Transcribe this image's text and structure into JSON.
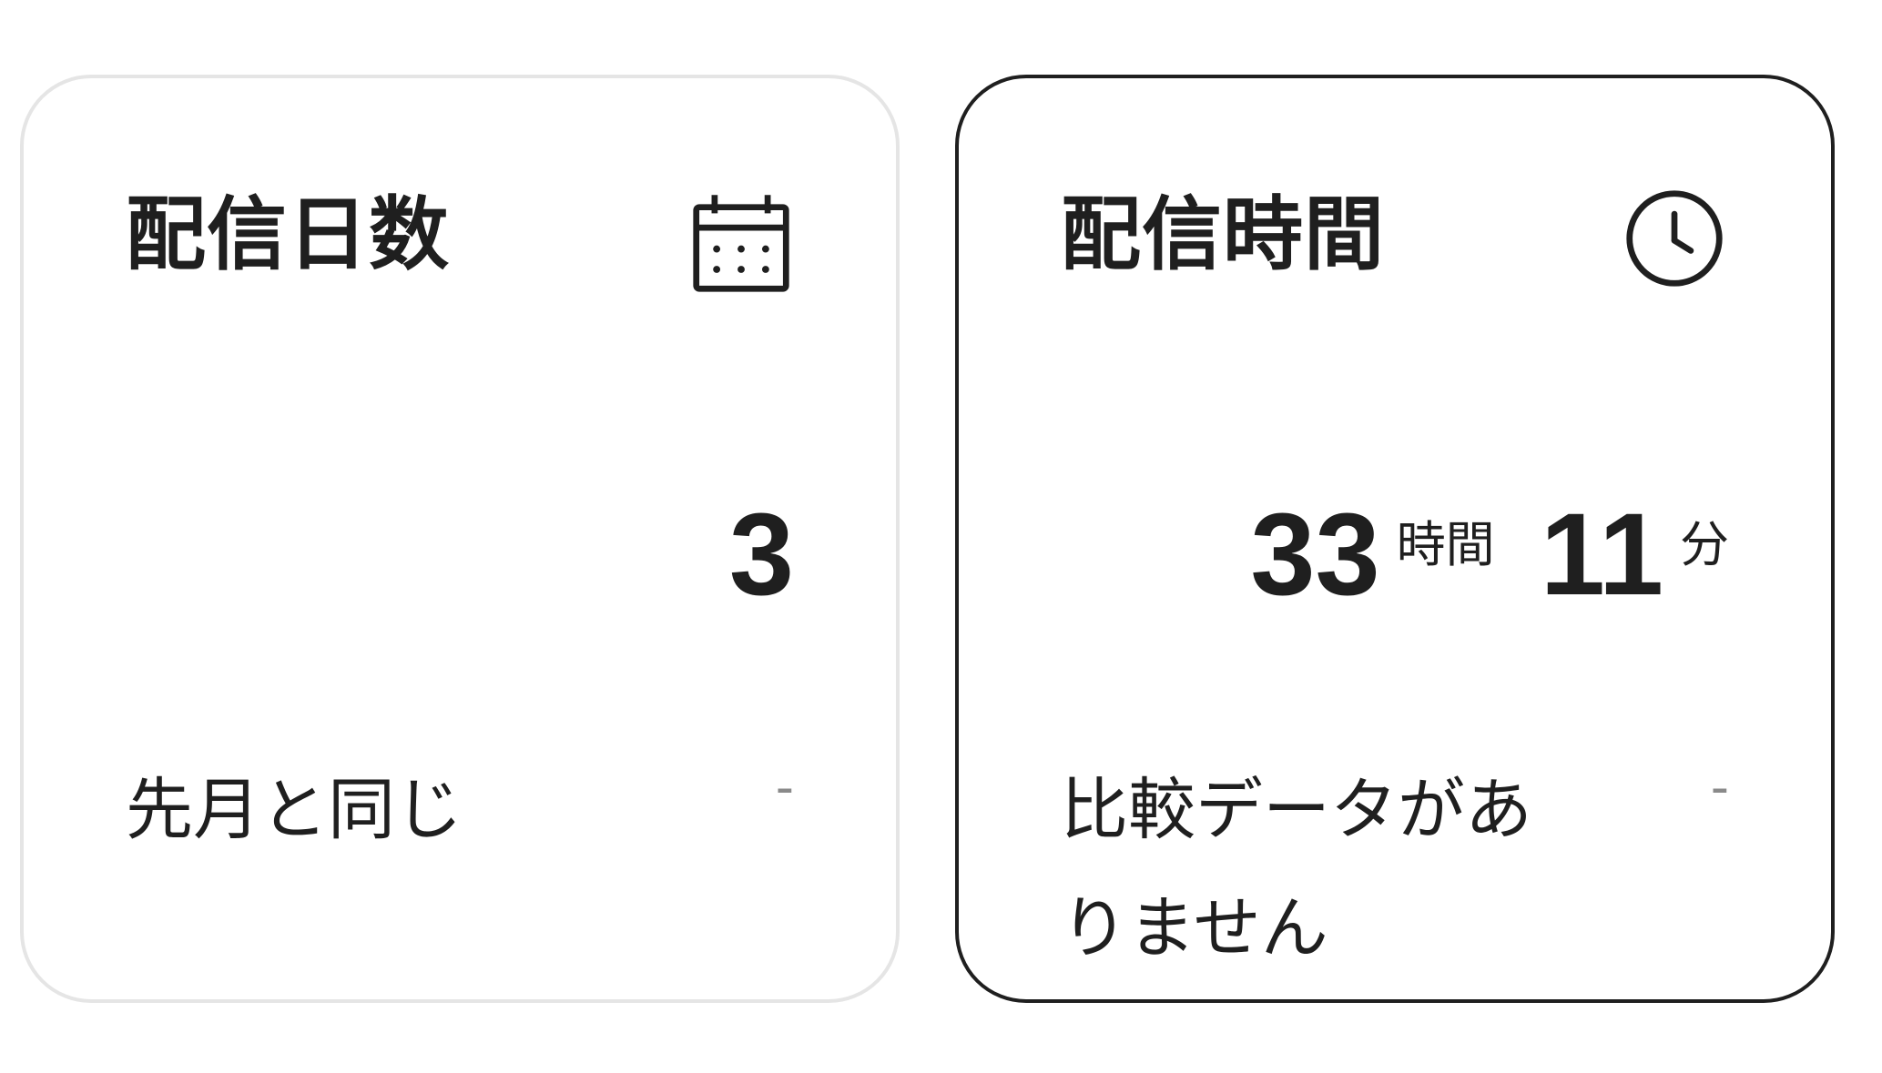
{
  "cards": [
    {
      "title": "配信日数",
      "icon": "calendar-icon",
      "value": "3",
      "comparison_text": "先月と同じ",
      "comparison_change": "-"
    },
    {
      "title": "配信時間",
      "icon": "clock-icon",
      "hours": "33",
      "hours_unit": "時間",
      "minutes": "11",
      "minutes_unit": "分",
      "comparison_text": "比較データがありません",
      "comparison_change": "-"
    }
  ],
  "colors": {
    "text": "#1f1f1f",
    "inactive_border": "#e5e5e5",
    "active_border": "#1f1f1f",
    "muted": "#8a8a8a"
  }
}
